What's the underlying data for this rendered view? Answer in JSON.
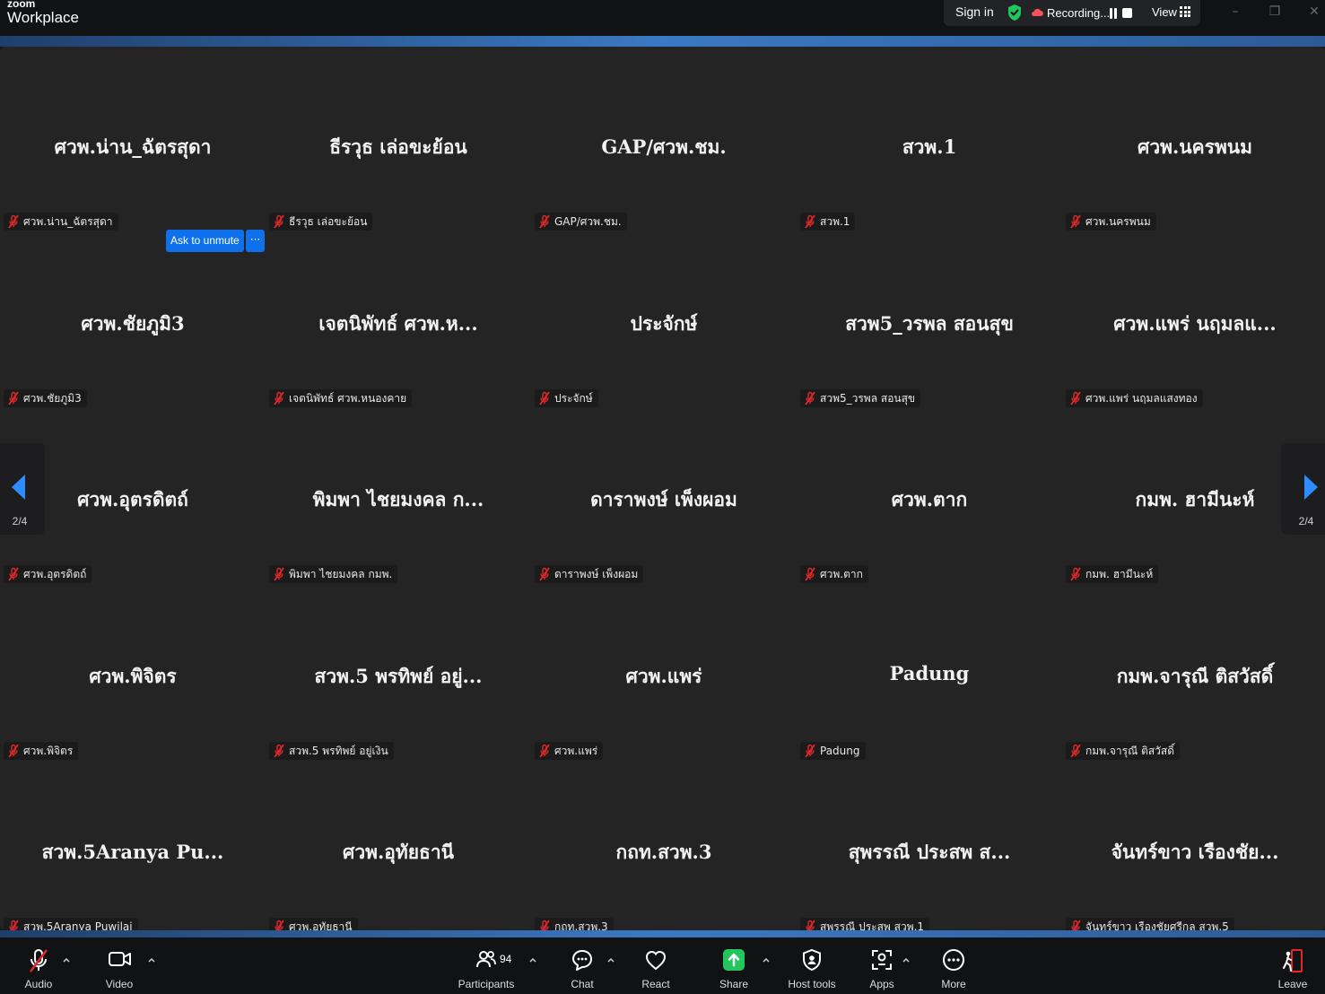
{
  "app": {
    "brand_small": "zoom",
    "brand_big": "Workplace"
  },
  "top": {
    "sign_in": "Sign in",
    "recording": "Recording...",
    "view": "View"
  },
  "window": {
    "minimize": "–",
    "restore": "❐",
    "close": "✕"
  },
  "colors": {
    "accent": "#0e71eb",
    "mic_off": "#e02828",
    "share_green": "#22c55e",
    "leave_red": "#e02828"
  },
  "tiles": [
    {
      "name": "ศวพ.น่าน_ฉัตรสุดา",
      "label": "ศวพ.น่าน_ฉัตรสุดา"
    },
    {
      "name": "ธีรวุธ   เล่อขะย้อน",
      "label": "ธีรวุธ   เล่อขะย้อน"
    },
    {
      "name": "GAP/ศวพ.ชม.",
      "label": "GAP/ศวพ.ชม."
    },
    {
      "name": "สวพ.1",
      "label": "สวพ.1"
    },
    {
      "name": "ศวพ.นครพนม",
      "label": "ศวพ.นครพนม"
    },
    {
      "name": "ศวพ.ชัยภูมิ3",
      "label": "ศวพ.ชัยภูมิ3"
    },
    {
      "name": "เจตนิพัทธ์ ศวพ.ห...",
      "label": "เจตนิพัทธ์ ศวพ.หนองคาย"
    },
    {
      "name": "ประจักษ์",
      "label": "ประจักษ์"
    },
    {
      "name": "สวพ5_วรพล สอนสุข",
      "label": "สวพ5_วรพล สอนสุข"
    },
    {
      "name": "ศวพ.แพร่  นฤมลแ...",
      "label": "ศวพ.แพร่  นฤมลแสงทอง"
    },
    {
      "name": "ศวพ.อุตรดิตถ์",
      "label": "ศวพ.อุตรดิตถ์"
    },
    {
      "name": "พิมพา  ไชยมงคล ก...",
      "label": "พิมพา  ไชยมงคล กมพ."
    },
    {
      "name": "ดาราพงษ์ เพ็งผอม",
      "label": "ดาราพงษ์ เพ็งผอม"
    },
    {
      "name": "ศวพ.ตาก",
      "label": "ศวพ.ตาก"
    },
    {
      "name": "กมพ. ฮามีนะห์",
      "label": "กมพ. ฮามีนะห์"
    },
    {
      "name": "ศวพ.พิจิตร",
      "label": "ศวพ.พิจิตร"
    },
    {
      "name": "สวพ.5 พรทิพย์ อยู่...",
      "label": "สวพ.5 พรทิพย์ อยู่เงิน"
    },
    {
      "name": "ศวพ.แพร่",
      "label": "ศวพ.แพร่"
    },
    {
      "name": "Padung",
      "label": "Padung"
    },
    {
      "name": "กมพ.จารุณี ติสวัสดิ์",
      "label": "กมพ.จารุณี ติสวัสดิ์"
    },
    {
      "name": "สวพ.5Aranya Pu...",
      "label": "สวพ.5Aranya Puwilai"
    },
    {
      "name": "ศวพ.อุทัยธานี",
      "label": "ศวพ.อุทัยธานี"
    },
    {
      "name": "กถท.สวพ.3",
      "label": "กถท.สวพ.3"
    },
    {
      "name": "สุพรรณี ประสพ  ส...",
      "label": "สุพรรณี ประสพ  สวพ.1"
    },
    {
      "name": "จันทร์ขาว เรืองชัย...",
      "label": "จันทร์ขาว เรืองชัยศรีกุล สวพ.5"
    }
  ],
  "hover": {
    "ask_to_unmute": "Ask to unmute",
    "more": "···"
  },
  "pager": {
    "left_page": "2/4",
    "right_page": "2/4"
  },
  "toolbar": {
    "audio": "Audio",
    "video": "Video",
    "participants": "Participants",
    "participants_count": "94",
    "chat": "Chat",
    "react": "React",
    "share": "Share",
    "host_tools": "Host tools",
    "apps": "Apps",
    "more": "More",
    "leave": "Leave"
  }
}
